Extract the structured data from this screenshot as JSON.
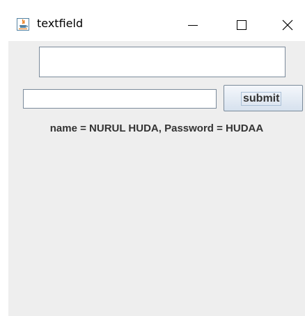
{
  "window": {
    "title": "textfield",
    "icon": "java-cup-icon"
  },
  "controls": {
    "minimize": "minimize-icon",
    "maximize": "maximize-icon",
    "close": "close-icon"
  },
  "form": {
    "top_field_value": "",
    "bottom_field_value": "",
    "submit_label": "submit",
    "result_text": "name = NURUL HUDA, Password = HUDAA"
  },
  "colors": {
    "panel_background": "#eeeeee",
    "field_border": "#7a8a9a",
    "label_text": "#333333",
    "java_icon_orange": "#e76f00",
    "java_icon_blue": "#5382a1"
  }
}
